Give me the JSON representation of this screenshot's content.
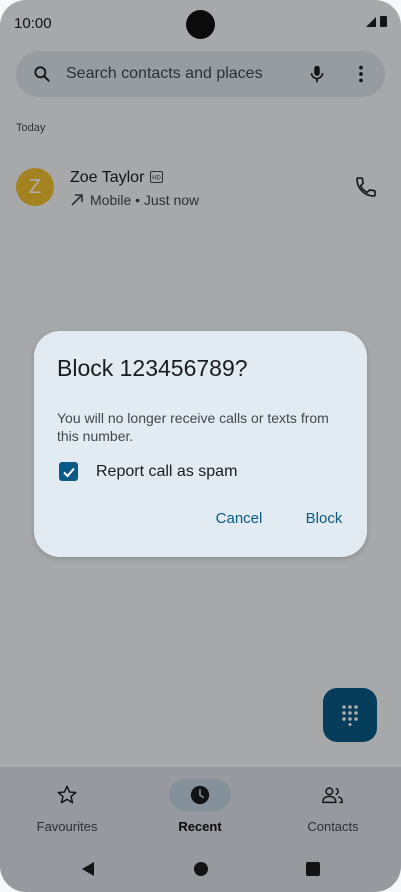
{
  "status_bar": {
    "time": "10:00"
  },
  "search": {
    "placeholder": "Search contacts and places"
  },
  "recents": {
    "section_label": "Today",
    "items": [
      {
        "avatar_letter": "Z",
        "name": "Zoe Taylor",
        "meta": "Mobile • Just now",
        "avatar_color": "#f2c030"
      }
    ]
  },
  "dialog": {
    "title": "Block 123456789?",
    "body": "You will no longer receive calls or texts from this number.",
    "checkbox_label": "Report call as spam",
    "checkbox_checked": true,
    "cancel_label": "Cancel",
    "block_label": "Block"
  },
  "bottom_nav": {
    "items": [
      {
        "label": "Favourites",
        "icon": "star-icon",
        "active": false
      },
      {
        "label": "Recent",
        "icon": "clock-icon",
        "active": true
      },
      {
        "label": "Contacts",
        "icon": "people-icon",
        "active": false
      }
    ]
  },
  "colors": {
    "accent": "#0a5a86",
    "dialog_bg": "#e3ebf2",
    "nav_bg": "#dde3e9"
  }
}
